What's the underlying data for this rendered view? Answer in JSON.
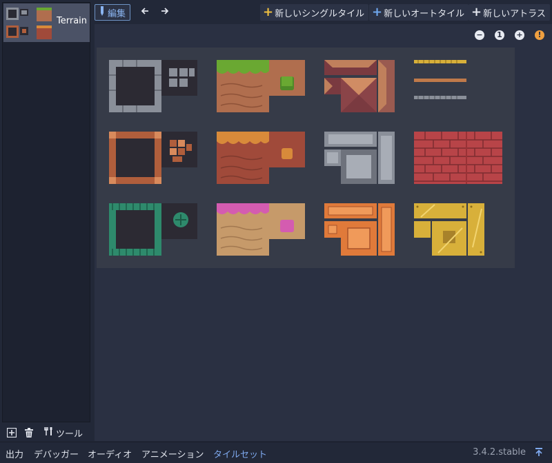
{
  "texture_list": {
    "items": [
      {
        "label": "Terrain (",
        "icon": "tileset-thumbnail"
      }
    ]
  },
  "left_toolbar": {
    "add_icon": "add-texture-icon",
    "delete_icon": "trash-icon",
    "tools_label": "ツール"
  },
  "toolbar": {
    "edit_label": "編集",
    "prev_icon": "arrow-left-icon",
    "next_icon": "arrow-right-icon",
    "new_single_tile": "新しいシングルタイル",
    "new_autotile": "新しいオートタイル",
    "new_atlas": "新しいアトラス"
  },
  "zoom": {
    "zoom_out": "−",
    "zoom_reset": "1",
    "zoom_in": "+",
    "warning": "!"
  },
  "bottom": {
    "tabs": [
      "出力",
      "デバッガー",
      "オーディオ",
      "アニメーション",
      "タイルセット"
    ],
    "active_tab": "タイルセット",
    "version": "3.4.2.stable"
  },
  "colors": {
    "accent": "#7faaf0",
    "stone": "#8a8f99",
    "grass": "#6aa832",
    "dirt": "#b06e4e",
    "wood": "#b05e3c",
    "brick": "#b84448",
    "teal": "#2e8a6c",
    "pink": "#d45cb0",
    "sand": "#c69a6a",
    "orange_box": "#e07a3a",
    "gold": "#d8b03a"
  }
}
